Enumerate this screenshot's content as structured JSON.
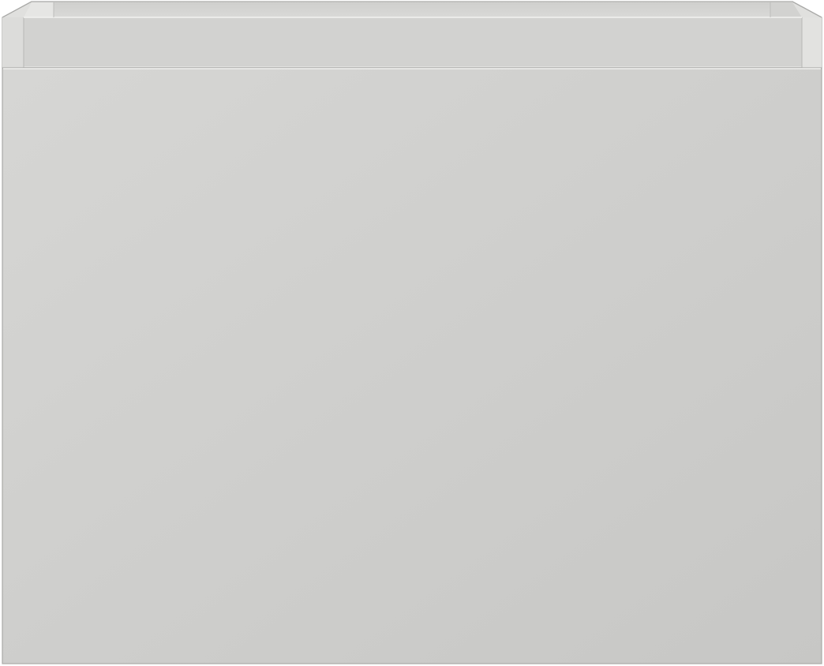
{
  "scene": {
    "subject": "cabinet-drawer-front",
    "colors": {
      "background": "#ffffff",
      "body_top": "#d6d6d4",
      "body_bottom": "#c7c7c5",
      "inner_back": "#c9c9c7",
      "inner_floor": "#dededc",
      "rim": "#e4e4e2",
      "edge_line": "#a9a9a7",
      "highlight": "#f2f2f0"
    }
  }
}
